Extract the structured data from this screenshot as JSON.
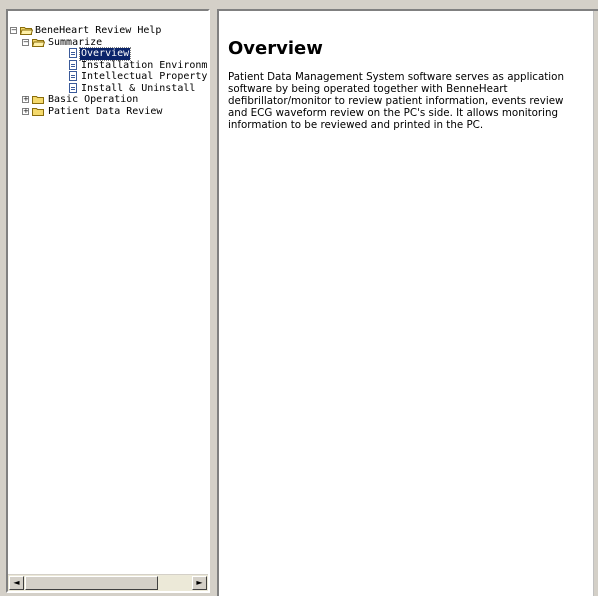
{
  "tree": {
    "items": [
      {
        "label": "BeneHeart Review Help",
        "level": 0,
        "type": "folder-open",
        "toggle": "−"
      },
      {
        "label": "Summarize",
        "level": 1,
        "type": "folder-open",
        "toggle": "−"
      },
      {
        "label": "Overview",
        "level": 2,
        "type": "doc",
        "selected": true
      },
      {
        "label": "Installation Environme",
        "level": 2,
        "type": "doc"
      },
      {
        "label": "Intellectual Property",
        "level": 2,
        "type": "doc"
      },
      {
        "label": "Install & Uninstall",
        "level": 2,
        "type": "doc"
      },
      {
        "label": "Basic Operation",
        "level": 1,
        "type": "folder",
        "toggle": "+"
      },
      {
        "label": "Patient Data Review",
        "level": 1,
        "type": "folder",
        "toggle": "+"
      }
    ]
  },
  "scrollbar": {
    "left_arrow": "◄",
    "right_arrow": "►"
  },
  "content": {
    "title": "Overview",
    "body": "Patient Data Management System software serves as application software by being operated together with BenneHeart defibrillator/monitor to review patient information, events review and ECG waveform review on the PC's side. It allows monitoring information to be reviewed and printed in the PC."
  },
  "colors": {
    "selection": "#0a246a",
    "folder": "#f4d96c",
    "window": "#d4d0c8"
  }
}
